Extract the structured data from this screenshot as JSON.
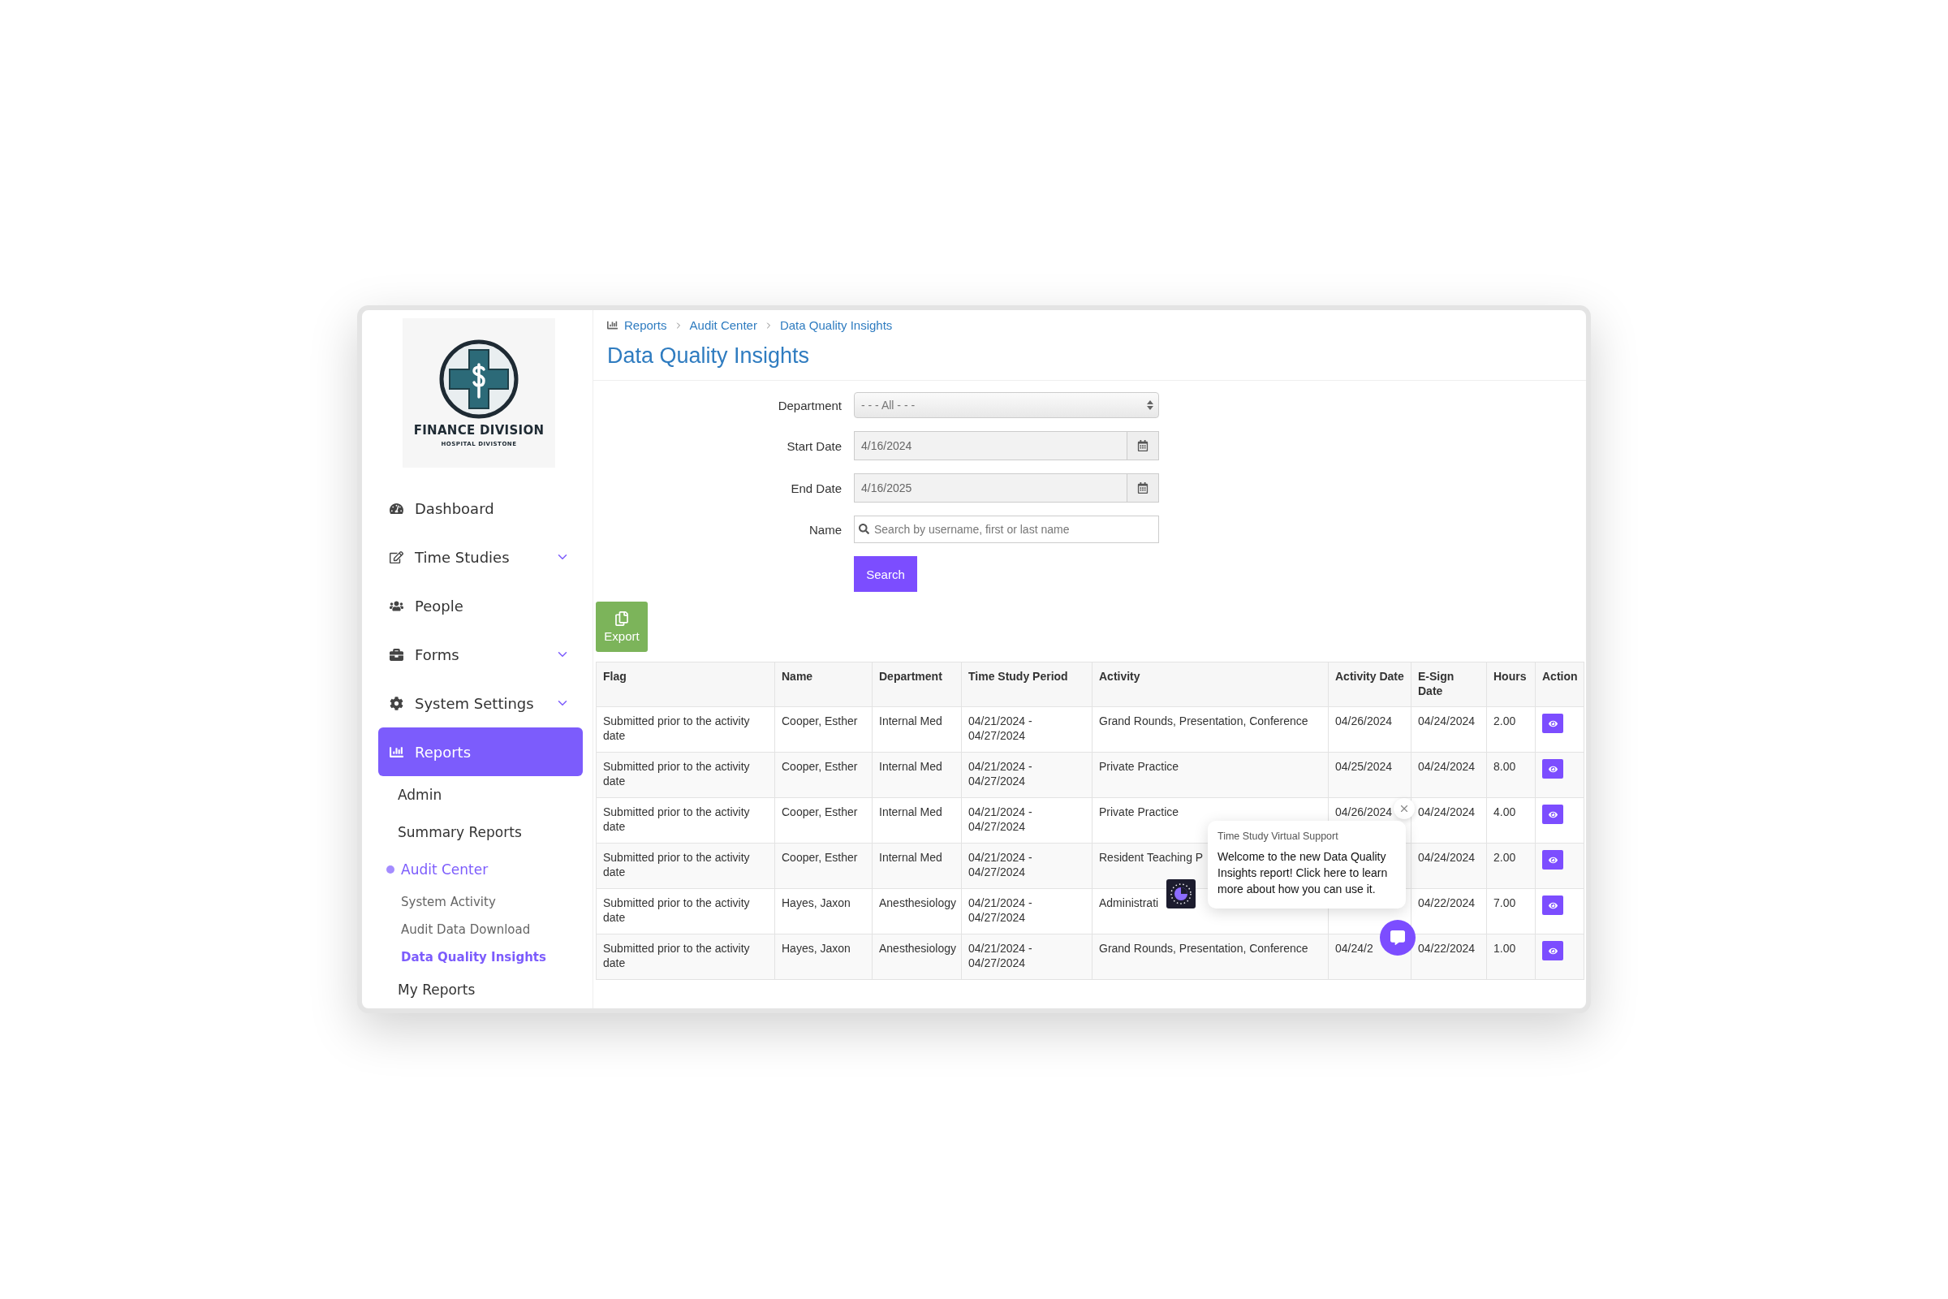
{
  "logo": {
    "title": "FINANCE DIVISION",
    "subtitle": "HOSPITAL DIVISTONE"
  },
  "sidebar": {
    "items": [
      {
        "label": "Dashboard",
        "expandable": false,
        "selected": false
      },
      {
        "label": "Time Studies",
        "expandable": true,
        "selected": false
      },
      {
        "label": "People",
        "expandable": false,
        "selected": false
      },
      {
        "label": "Forms",
        "expandable": true,
        "selected": false
      },
      {
        "label": "System Settings",
        "expandable": true,
        "selected": false
      },
      {
        "label": "Reports",
        "expandable": false,
        "selected": true,
        "children": [
          {
            "label": "Admin",
            "selected": false
          },
          {
            "label": "Summary Reports",
            "selected": false
          },
          {
            "label": "Audit Center",
            "selected": true,
            "children": [
              {
                "label": "System Activity",
                "selected": false
              },
              {
                "label": "Audit Data Download",
                "selected": false
              },
              {
                "label": "Data Quality Insights",
                "selected": true
              }
            ]
          },
          {
            "label": "My Reports",
            "selected": false
          }
        ]
      }
    ]
  },
  "breadcrumb": [
    "Reports",
    "Audit Center",
    "Data Quality Insights"
  ],
  "title": "Data Quality Insights",
  "filters": {
    "department": {
      "label": "Department",
      "value": "- - - All - - -"
    },
    "start_date": {
      "label": "Start Date",
      "value": "4/16/2024"
    },
    "end_date": {
      "label": "End Date",
      "value": "4/16/2025"
    },
    "name": {
      "label": "Name",
      "placeholder": "Search by username, first or last name"
    },
    "search_button": "Search"
  },
  "export_button": "Export",
  "table": {
    "columns": [
      "Flag",
      "Name",
      "Department",
      "Time Study Period",
      "Activity",
      "Activity Date",
      "E-Sign Date",
      "Hours",
      "Action"
    ],
    "rows": [
      {
        "cells": [
          "Submitted prior to the activity date",
          "Cooper, Esther",
          "Internal Med",
          "04/21/2024 - 04/27/2024",
          "Grand Rounds, Presentation, Conference",
          "04/26/2024",
          "04/24/2024",
          "2.00"
        ]
      },
      {
        "cells": [
          "Submitted prior to the activity date",
          "Cooper, Esther",
          "Internal Med",
          "04/21/2024 - 04/27/2024",
          "Private Practice",
          "04/25/2024",
          "04/24/2024",
          "8.00"
        ]
      },
      {
        "cells": [
          "Submitted prior to the activity date",
          "Cooper, Esther",
          "Internal Med",
          "04/21/2024 - 04/27/2024",
          "Private Practice",
          "04/26/2024",
          "04/24/2024",
          "4.00"
        ]
      },
      {
        "cells": [
          "Submitted prior to the activity date",
          "Cooper, Esther",
          "Internal Med",
          "04/21/2024 - 04/27/2024",
          "Resident Teaching P",
          null,
          "04/24/2024",
          "2.00"
        ]
      },
      {
        "cells": [
          "Submitted prior to the activity date",
          "Hayes, Jaxon",
          "Anesthesiology",
          "04/21/2024 - 04/27/2024",
          "Administrati",
          null,
          "04/22/2024",
          "7.00"
        ]
      },
      {
        "cells": [
          "Submitted prior to the activity date",
          "Hayes, Jaxon",
          "Anesthesiology",
          "04/21/2024 - 04/27/2024",
          "Grand Rounds, Presentation, Conference",
          "04/24/2",
          "04/22/2024",
          "1.00"
        ]
      }
    ]
  },
  "support_popup": {
    "sender": "Time Study Virtual Support",
    "message": "Welcome to the new Data Quality Insights report! Click here to learn more about how you can use it."
  }
}
